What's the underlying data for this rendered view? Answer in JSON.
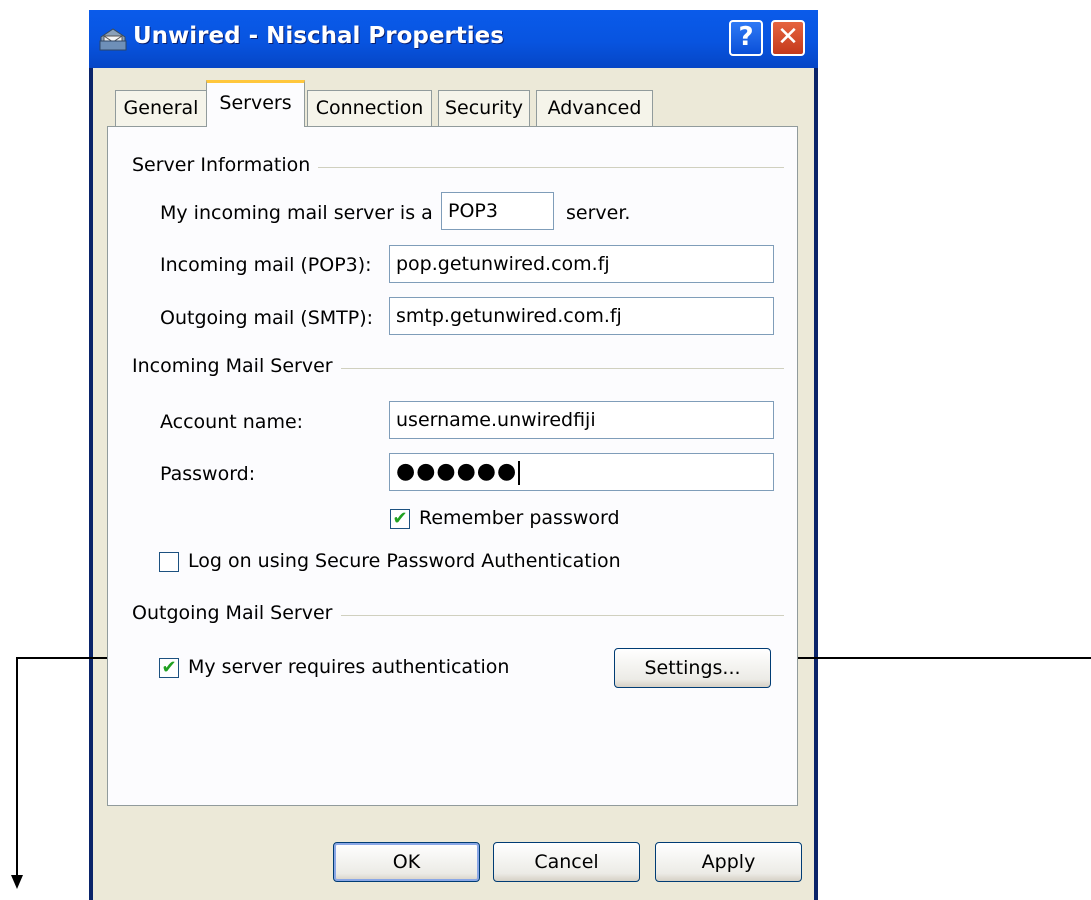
{
  "window": {
    "title": "Unwired - Nischal Properties",
    "help_label": "?",
    "close_label": "✕"
  },
  "tabs": [
    {
      "label": "General"
    },
    {
      "label": "Servers",
      "active": true
    },
    {
      "label": "Connection"
    },
    {
      "label": "Security"
    },
    {
      "label": "Advanced"
    }
  ],
  "server_info": {
    "group_label": "Server Information",
    "incoming_prefix": "My incoming mail server is a",
    "server_type": "POP3",
    "incoming_suffix": "server.",
    "incoming_label": "Incoming mail (POP3):",
    "incoming_value": "pop.getunwired.com.fj",
    "outgoing_label": "Outgoing mail (SMTP):",
    "outgoing_value": "smtp.getunwired.com.fj"
  },
  "incoming_server": {
    "group_label": "Incoming Mail Server",
    "account_label": "Account name:",
    "account_value": "username.unwiredfiji",
    "password_label": "Password:",
    "password_value": "●●●●●●",
    "remember_label": "Remember password",
    "remember_checked": true,
    "spa_label": "Log on using Secure Password Authentication",
    "spa_checked": false
  },
  "outgoing_server": {
    "group_label": "Outgoing Mail Server",
    "auth_label": "My server requires authentication",
    "auth_checked": true,
    "settings_label": "Settings..."
  },
  "buttons": {
    "ok": "OK",
    "cancel": "Cancel",
    "apply": "Apply"
  },
  "check_mark": "✔"
}
